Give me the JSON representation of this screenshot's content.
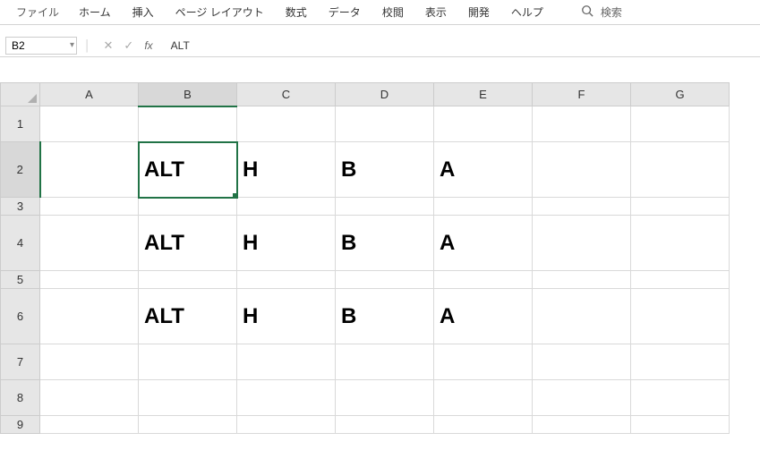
{
  "ribbon": {
    "tabs": [
      "ファイル",
      "ホーム",
      "挿入",
      "ページ レイアウト",
      "数式",
      "データ",
      "校閲",
      "表示",
      "開発",
      "ヘルプ"
    ],
    "search_placeholder": "検索"
  },
  "formula_bar": {
    "name_box": "B2",
    "formula": "ALT"
  },
  "columns": [
    "A",
    "B",
    "C",
    "D",
    "E",
    "F",
    "G"
  ],
  "rows": [
    {
      "n": "1",
      "h": "norm",
      "cells": [
        "",
        "",
        "",
        "",
        "",
        "",
        ""
      ]
    },
    {
      "n": "2",
      "h": "big",
      "cells": [
        "",
        "ALT",
        "H",
        "B",
        "A",
        "",
        ""
      ]
    },
    {
      "n": "3",
      "h": "small",
      "cells": [
        "",
        "",
        "",
        "",
        "",
        "",
        ""
      ]
    },
    {
      "n": "4",
      "h": "big",
      "cells": [
        "",
        "ALT",
        "H",
        "B",
        "A",
        "",
        ""
      ]
    },
    {
      "n": "5",
      "h": "small",
      "cells": [
        "",
        "",
        "",
        "",
        "",
        "",
        ""
      ]
    },
    {
      "n": "6",
      "h": "big",
      "cells": [
        "",
        "ALT",
        "H",
        "B",
        "A",
        "",
        ""
      ]
    },
    {
      "n": "7",
      "h": "norm",
      "cells": [
        "",
        "",
        "",
        "",
        "",
        "",
        ""
      ]
    },
    {
      "n": "8",
      "h": "norm",
      "cells": [
        "",
        "",
        "",
        "",
        "",
        "",
        ""
      ]
    },
    {
      "n": "9",
      "h": "small",
      "cells": [
        "",
        "",
        "",
        "",
        "",
        "",
        ""
      ]
    }
  ],
  "active_cell": {
    "row": "2",
    "col": "B"
  }
}
